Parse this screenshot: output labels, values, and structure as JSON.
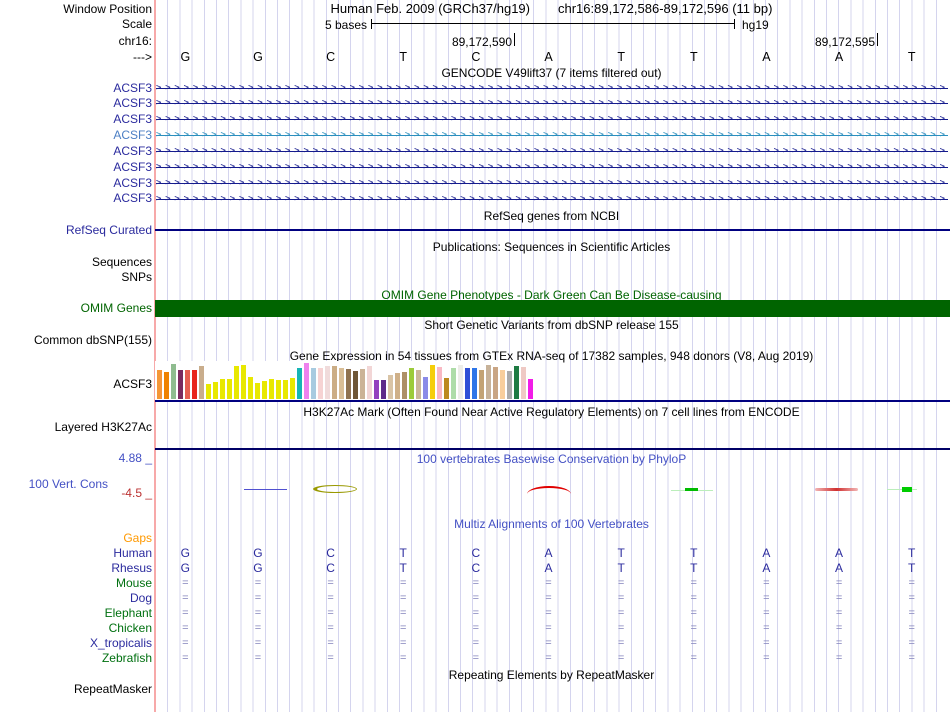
{
  "window": {
    "assembly_title": "Human Feb. 2009 (GRCh37/hg19)",
    "range_title": "chr16:89,172,586-89,172,596 (11 bp)",
    "left_labels": {
      "window_position": "Window Position",
      "scale": "Scale",
      "chrom": "chr16:",
      "direction": "--->"
    },
    "scale": {
      "value": "5 bases",
      "assembly": "hg19"
    },
    "coords": {
      "first": "89,172,590",
      "second": "89,172,595"
    },
    "bases": [
      "G",
      "G",
      "C",
      "T",
      "C",
      "A",
      "T",
      "T",
      "A",
      "A",
      "T"
    ],
    "arrow_char": ">"
  },
  "colors": {
    "grid_line": "#d4d4ee",
    "label_divider": "#f7a9a9",
    "gene_dark": "#151b8d",
    "gene_light": "#2b8fbe",
    "omim_bar": "#006400",
    "track_baseline": "#000080"
  },
  "tracks": {
    "gencode": {
      "title": "GENCODE V49lift37 (7 items filtered out)",
      "items": [
        {
          "label": "ACSF3",
          "variant": "dark"
        },
        {
          "label": "ACSF3",
          "variant": "dark"
        },
        {
          "label": "ACSF3",
          "variant": "dark"
        },
        {
          "label": "ACSF3",
          "variant": "light"
        },
        {
          "label": "ACSF3",
          "variant": "dark"
        },
        {
          "label": "ACSF3",
          "variant": "dark"
        },
        {
          "label": "ACSF3",
          "variant": "dark"
        },
        {
          "label": "ACSF3",
          "variant": "dark"
        }
      ]
    },
    "refseq": {
      "title": "RefSeq genes from NCBI",
      "label": "RefSeq Curated"
    },
    "publications": {
      "title": "Publications: Sequences in Scientific Articles",
      "sequences_label": "Sequences",
      "snps_label": "SNPs"
    },
    "omim": {
      "title": "OMIM Gene Phenotypes - Dark Green Can Be Disease-causing",
      "label": "OMIM Genes"
    },
    "dbsnp": {
      "title": "Short Genetic Variants from dbSNP release 155",
      "label": "Common dbSNP(155)"
    },
    "gtex": {
      "title": "Gene Expression in 54 tissues from GTEx RNA-seq of 17382 samples, 948 donors (V8, Aug 2019)",
      "label": "ACSF3",
      "bars": [
        {
          "c": "#F59638",
          "h": 0.8
        },
        {
          "c": "#EF8200",
          "h": 0.75
        },
        {
          "c": "#8FBC8F",
          "h": 0.97
        },
        {
          "c": "#7B2B60",
          "h": 0.8
        },
        {
          "c": "#E65F52",
          "h": 0.8
        },
        {
          "c": "#E8261C",
          "h": 0.8
        },
        {
          "c": "#C9AD8C",
          "h": 0.93
        },
        {
          "c": "#E8E800",
          "h": 0.42
        },
        {
          "c": "#E8E800",
          "h": 0.48
        },
        {
          "c": "#E8E800",
          "h": 0.55
        },
        {
          "c": "#E8E800",
          "h": 0.55
        },
        {
          "c": "#E8E800",
          "h": 0.92
        },
        {
          "c": "#E8E800",
          "h": 0.95
        },
        {
          "c": "#E8E800",
          "h": 0.6
        },
        {
          "c": "#E8E800",
          "h": 0.45
        },
        {
          "c": "#E8E800",
          "h": 0.5
        },
        {
          "c": "#E8E800",
          "h": 0.55
        },
        {
          "c": "#E8E800",
          "h": 0.52
        },
        {
          "c": "#E8E800",
          "h": 0.52
        },
        {
          "c": "#E8E800",
          "h": 0.58
        },
        {
          "c": "#17B5B5",
          "h": 0.85
        },
        {
          "c": "#EE82EE",
          "h": 1.0
        },
        {
          "c": "#A8CBE0",
          "h": 0.85
        },
        {
          "c": "#F6D3D3",
          "h": 0.86
        },
        {
          "c": "#F0DBDB",
          "h": 0.93
        },
        {
          "c": "#CBAD85",
          "h": 0.92
        },
        {
          "c": "#D9BE96",
          "h": 0.85
        },
        {
          "c": "#8F7250",
          "h": 0.82
        },
        {
          "c": "#6E5636",
          "h": 0.78
        },
        {
          "c": "#CBB396",
          "h": 0.82
        },
        {
          "c": "#F2D6D6",
          "h": 0.93
        },
        {
          "c": "#9340BF",
          "h": 0.52
        },
        {
          "c": "#5E2B8A",
          "h": 0.52
        },
        {
          "c": "#D9C4A6",
          "h": 0.66
        },
        {
          "c": "#CFB088",
          "h": 0.72
        },
        {
          "c": "#AD9066",
          "h": 0.75
        },
        {
          "c": "#9CCB3B",
          "h": 0.85
        },
        {
          "c": "#CBB79B",
          "h": 0.8
        },
        {
          "c": "#8A8AE8",
          "h": 0.6
        },
        {
          "c": "#F5CE0A",
          "h": 0.95
        },
        {
          "c": "#F9B9C4",
          "h": 0.9
        },
        {
          "c": "#BB8A1F",
          "h": 0.58
        },
        {
          "c": "#AEDCA8",
          "h": 0.85
        },
        {
          "c": "#EDEDE8",
          "h": 0.95
        },
        {
          "c": "#2E4FD6",
          "h": 0.85
        },
        {
          "c": "#2D75E8",
          "h": 0.85
        },
        {
          "c": "#C3A375",
          "h": 0.8
        },
        {
          "c": "#C7B299",
          "h": 0.95
        },
        {
          "c": "#C9A584",
          "h": 0.88
        },
        {
          "c": "#F8CE9C",
          "h": 0.8
        },
        {
          "c": "#ABABAB",
          "h": 0.78
        },
        {
          "c": "#1E7B43",
          "h": 0.92
        },
        {
          "c": "#EFC9C4",
          "h": 0.9
        },
        {
          "c": "#F21CE8",
          "h": 0.55
        }
      ]
    },
    "h3k27ac": {
      "title": "H3K27Ac Mark (Often Found Near Active Regulatory Elements) on 7 cell lines from ENCODE",
      "label": "Layered H3K27Ac"
    },
    "phylop": {
      "title": "100 vertebrates Basewise Conservation by PhyloP",
      "label": "100 Vert. Cons",
      "max": "4.88 _",
      "min": "-4.5 _"
    },
    "multiz": {
      "title": "Multiz Alignments of 100 Vertebrates",
      "gaps_label": "Gaps",
      "rows": [
        {
          "label": "Human",
          "cells": [
            "G",
            "G",
            "C",
            "T",
            "C",
            "A",
            "T",
            "T",
            "A",
            "A",
            "T"
          ]
        },
        {
          "label": "Rhesus",
          "cells": [
            "G",
            "G",
            "C",
            "T",
            "C",
            "A",
            "T",
            "T",
            "A",
            "A",
            "T"
          ]
        },
        {
          "label": "Mouse",
          "cells": [
            "=",
            "=",
            "=",
            "=",
            "=",
            "=",
            "=",
            "=",
            "=",
            "=",
            "="
          ]
        },
        {
          "label": "Dog",
          "cells": [
            "=",
            "=",
            "=",
            "=",
            "=",
            "=",
            "=",
            "=",
            "=",
            "=",
            "="
          ]
        },
        {
          "label": "Elephant",
          "cells": [
            "=",
            "=",
            "=",
            "=",
            "=",
            "=",
            "=",
            "=",
            "=",
            "=",
            "="
          ]
        },
        {
          "label": "Chicken",
          "cells": [
            "=",
            "=",
            "=",
            "=",
            "=",
            "=",
            "=",
            "=",
            "=",
            "=",
            "="
          ]
        },
        {
          "label": "X_tropicalis",
          "cells": [
            "=",
            "=",
            "=",
            "=",
            "=",
            "=",
            "=",
            "=",
            "=",
            "=",
            "="
          ]
        },
        {
          "label": "Zebrafish",
          "cells": [
            "=",
            "=",
            "=",
            "=",
            "=",
            "=",
            "=",
            "=",
            "=",
            "=",
            "="
          ]
        }
      ]
    },
    "repeatmasker": {
      "title": "Repeating Elements by RepeatMasker",
      "label": "RepeatMasker"
    }
  }
}
